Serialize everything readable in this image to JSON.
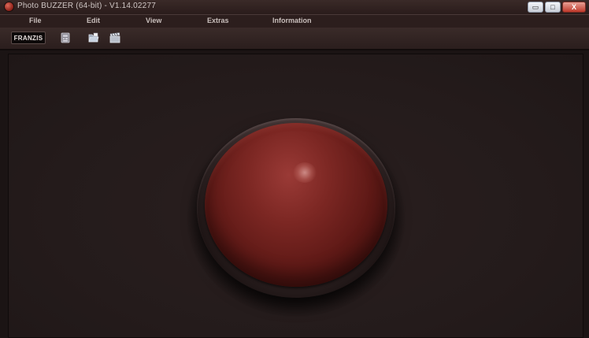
{
  "window": {
    "title": "Photo BUZZER (64-bit) - V1.14.02277",
    "buttons": {
      "minimize": "▭",
      "maximize": "□",
      "close": "X"
    }
  },
  "menu": {
    "items": [
      {
        "label": "File"
      },
      {
        "label": "Edit"
      },
      {
        "label": "View"
      },
      {
        "label": "Extras"
      },
      {
        "label": "Information"
      }
    ]
  },
  "toolbar": {
    "logo": "FRANZIS",
    "icons": [
      "camera-settings-icon",
      "open-folder-icon",
      "clapperboard-icon"
    ]
  },
  "buzzer": {
    "color": "#7c2723",
    "icon": "buzzer-button"
  }
}
